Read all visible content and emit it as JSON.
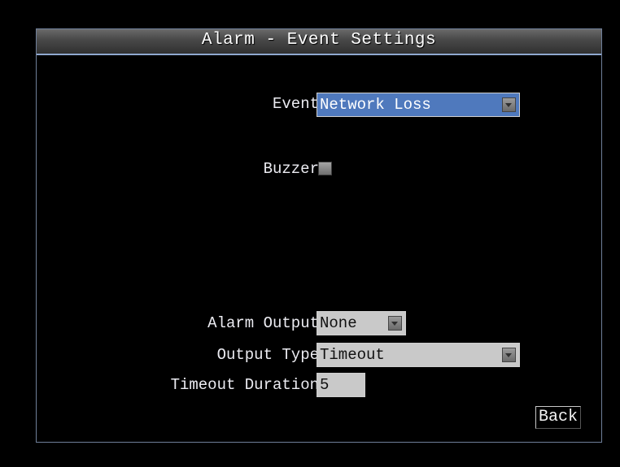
{
  "dialog": {
    "title": "Alarm - Event Settings"
  },
  "fields": {
    "event": {
      "label": "Event",
      "value": "Network Loss"
    },
    "buzzer": {
      "label": "Buzzer",
      "checked": false
    },
    "alarm_output": {
      "label": "Alarm Output",
      "value": "None"
    },
    "output_type": {
      "label": "Output Type",
      "value": "Timeout"
    },
    "timeout_duration": {
      "label": "Timeout Duration",
      "value": "5"
    }
  },
  "buttons": {
    "back_label": "Back"
  },
  "colors": {
    "highlight": "#4f79bd",
    "field_bg": "#c9c9c9",
    "border": "#6f7f9a",
    "title_accent": "#8fa8cf"
  },
  "icons": {
    "dropdown_arrow": "chevron-down-icon"
  }
}
